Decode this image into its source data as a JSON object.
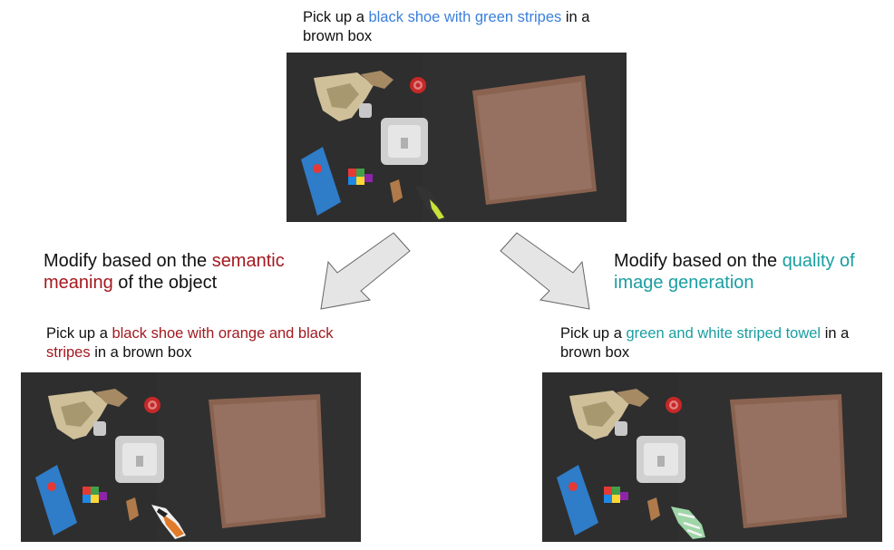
{
  "top": {
    "caption": {
      "pre": "Pick up a ",
      "highlight": "black shoe with green stripes",
      "post": " in a brown box"
    },
    "accent": "#3a7fdc",
    "shoe_color": "#c9e23a"
  },
  "left_label": {
    "pre": "Modify based on the ",
    "highlight": "semantic meaning",
    "post": " of the object",
    "accent": "#a3191f"
  },
  "right_label": {
    "pre": "Modify based on the ",
    "highlight": "quality of image generation",
    "post": "",
    "accent": "#1a9ea0"
  },
  "left": {
    "caption": {
      "pre": "Pick up a ",
      "highlight": "black shoe with orange and black stripes",
      "post": " in a brown box"
    },
    "shoe_color": "#e07b2a"
  },
  "right": {
    "caption": {
      "pre": "Pick up a ",
      "highlight": "green and white striped towel",
      "post": " in a brown box"
    },
    "shoe_color": "#9ed6a8"
  }
}
